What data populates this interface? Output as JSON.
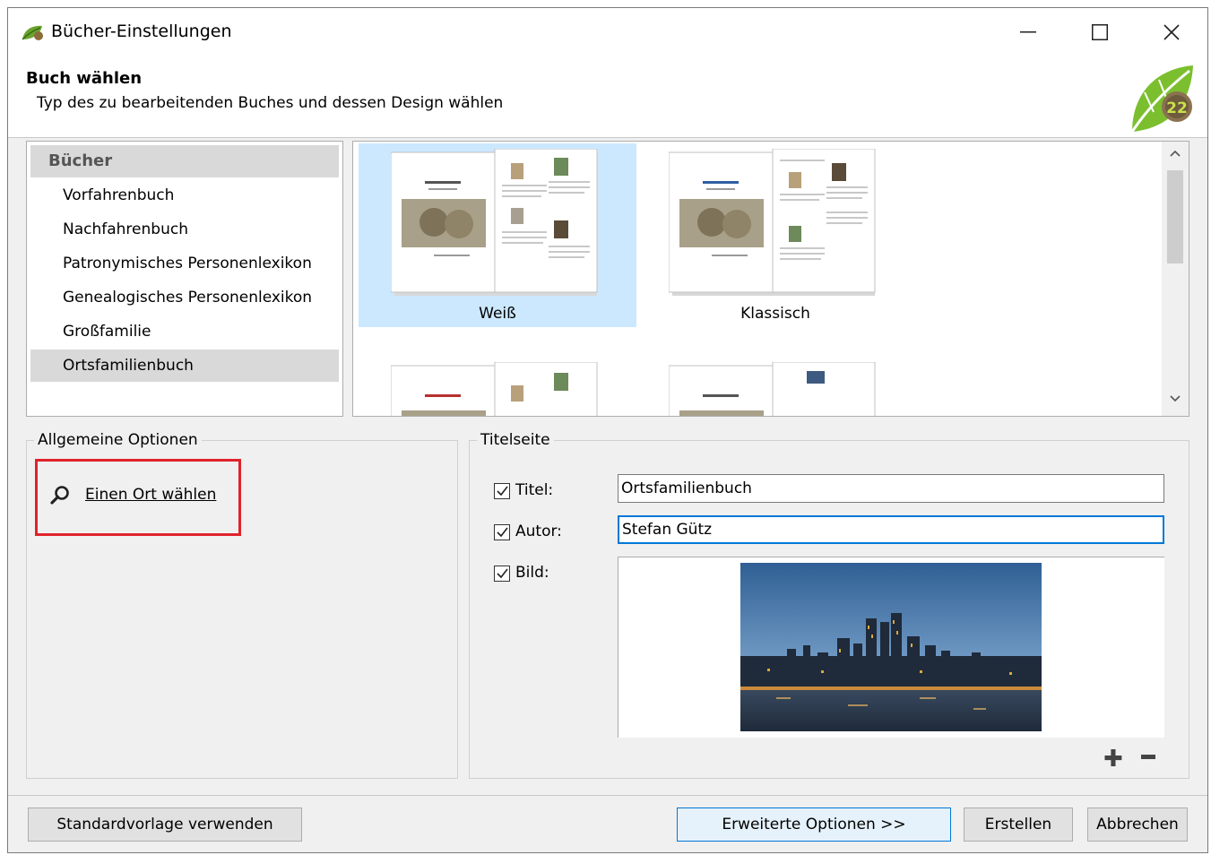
{
  "window": {
    "title": "Bücher-Einstellungen",
    "minimize_icon": "minimize-icon",
    "maximize_icon": "maximize-icon",
    "close_icon": "close-icon"
  },
  "header": {
    "title": "Buch wählen",
    "subtitle": "Typ des zu bearbeitenden Buches und dessen Design wählen",
    "logo_text": "22"
  },
  "booklist": {
    "heading": "Bücher",
    "items": [
      {
        "label": "Vorfahrenbuch",
        "selected": false
      },
      {
        "label": "Nachfahrenbuch",
        "selected": false
      },
      {
        "label": "Patronymisches Personenlexikon",
        "selected": false
      },
      {
        "label": "Genealogisches Personenlexikon",
        "selected": false
      },
      {
        "label": "Großfamilie",
        "selected": false
      },
      {
        "label": "Ortsfamilienbuch",
        "selected": true
      }
    ]
  },
  "designs": {
    "tiles": [
      {
        "label": "Weiß",
        "selected": true
      },
      {
        "label": "Klassisch",
        "selected": false
      }
    ],
    "scroll_up_icon": "chevron-up-icon",
    "scroll_down_icon": "chevron-down-icon"
  },
  "general_options": {
    "legend": "Allgemeine Optionen",
    "choose_location_link": "Einen Ort wählen",
    "icon": "search-icon"
  },
  "title_page": {
    "legend": "Titelseite",
    "title_label": "Titel:",
    "title_checked": true,
    "title_value": "Ortsfamilienbuch",
    "author_label": "Autor:",
    "author_checked": true,
    "author_value": "Stefan Gütz",
    "image_label": "Bild:",
    "image_checked": true,
    "add_icon": "plus-icon",
    "remove_icon": "minus-icon"
  },
  "footer": {
    "default_template_button": "Standardvorlage verwenden",
    "advanced_button": "Erweiterte Optionen >>",
    "create_button": "Erstellen",
    "cancel_button": "Abbrechen"
  },
  "colors": {
    "selection": "#cce8ff",
    "highlight_box": "#e0222b",
    "focus": "#0078d7"
  }
}
